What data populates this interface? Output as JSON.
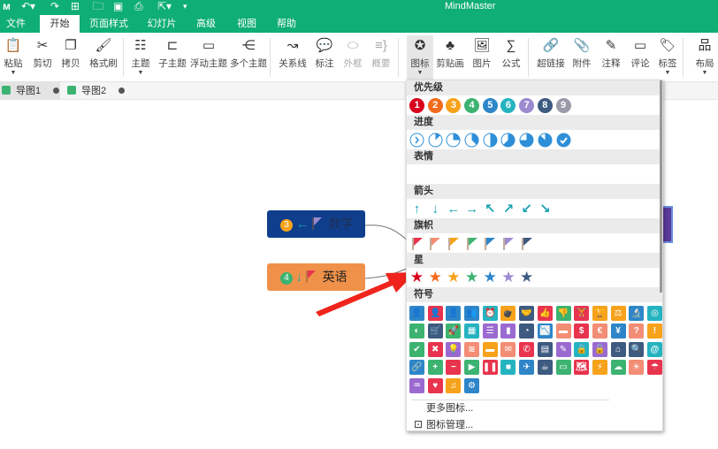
{
  "titlebar": {
    "title": "MindMaster",
    "quick_access": [
      "logo",
      "undo",
      "redo",
      "new",
      "open",
      "save",
      "print",
      "export",
      "more"
    ]
  },
  "menu_tabs": [
    "文件",
    "开始",
    "页面样式",
    "幻灯片",
    "高级",
    "视图",
    "帮助"
  ],
  "active_tab": "开始",
  "ribbon": [
    {
      "label": "粘贴",
      "icon": "paste-icon",
      "dropdown": true
    },
    {
      "label": "剪切",
      "icon": "scissors-icon"
    },
    {
      "label": "拷贝",
      "icon": "copy-icon"
    },
    {
      "label": "格式刷",
      "icon": "format-brush-icon"
    },
    {
      "label": "主题",
      "icon": "topic-icon",
      "dropdown": true
    },
    {
      "label": "子主题",
      "icon": "subtopic-icon"
    },
    {
      "label": "浮动主题",
      "icon": "floating-topic-icon"
    },
    {
      "label": "多个主题",
      "icon": "multiple-topics-icon"
    },
    {
      "label": "关系线",
      "icon": "relationship-icon"
    },
    {
      "label": "标注",
      "icon": "callout-icon"
    },
    {
      "label": "外框",
      "icon": "boundary-icon",
      "disabled": true
    },
    {
      "label": "概要",
      "icon": "summary-icon",
      "disabled": true
    },
    {
      "label": "图标",
      "icon": "icon-icon",
      "dropdown": true,
      "selected": true
    },
    {
      "label": "剪贴画",
      "icon": "clipart-icon"
    },
    {
      "label": "图片",
      "icon": "image-icon"
    },
    {
      "label": "公式",
      "icon": "formula-icon"
    },
    {
      "label": "超链接",
      "icon": "hyperlink-icon"
    },
    {
      "label": "附件",
      "icon": "attachment-icon"
    },
    {
      "label": "注释",
      "icon": "note-icon"
    },
    {
      "label": "评论",
      "icon": "comment-icon"
    },
    {
      "label": "标签",
      "icon": "tag-icon",
      "dropdown": true
    },
    {
      "label": "布局",
      "icon": "layout-icon",
      "dropdown": true
    }
  ],
  "doc_tabs": [
    "导图1",
    "导图2"
  ],
  "nodes": [
    {
      "label": "数学",
      "number": "3",
      "number_color": "#f7a21b",
      "arrow": "←",
      "flag_color": "#9b8ad0",
      "bg": "#0f3f8c",
      "text_color": "#1f2f55"
    },
    {
      "label": "英语",
      "number": "4",
      "number_color": "#3cb371",
      "arrow": "↓",
      "flag_color": "#e8344e",
      "bg": "#f0914a",
      "text_color": "#222"
    }
  ],
  "icon_panel": {
    "sections": {
      "priority": {
        "title": "优先级",
        "items": [
          {
            "n": "1",
            "c": "#d9001b"
          },
          {
            "n": "2",
            "c": "#f26b1d"
          },
          {
            "n": "3",
            "c": "#f7a21b"
          },
          {
            "n": "4",
            "c": "#3cb371"
          },
          {
            "n": "5",
            "c": "#2e86c9"
          },
          {
            "n": "6",
            "c": "#26b3c0"
          },
          {
            "n": "7",
            "c": "#9b8ad0"
          },
          {
            "n": "8",
            "c": "#3d5a80"
          },
          {
            "n": "9",
            "c": "#9a9aa8"
          }
        ]
      },
      "progress": {
        "title": "进度",
        "items": [
          0,
          12.5,
          25,
          37.5,
          50,
          62.5,
          75,
          87.5,
          100
        ]
      },
      "emoji": {
        "title": "表情",
        "items": [
          "😁",
          "😊",
          "😐",
          "😒",
          "😡",
          "😭",
          "😠",
          "😲",
          "😏",
          "😑",
          "😵",
          "😆",
          "😶",
          "😍"
        ]
      },
      "arrows": {
        "title": "箭头",
        "items": [
          "↑",
          "↓",
          "←",
          "→",
          "↖",
          "↗",
          "↙",
          "↘"
        ],
        "color": "#1aa3b0"
      },
      "flags": {
        "title": "旗帜",
        "items": [
          "#e8344e",
          "#f38d75",
          "#f7a21b",
          "#3cb371",
          "#2e86c9",
          "#9b8ad0",
          "#3d5a80"
        ]
      },
      "stars": {
        "title": "星",
        "items": [
          "#d9001b",
          "#f26b1d",
          "#f7a21b",
          "#3cb371",
          "#2e86c9",
          "#9b8ad0",
          "#3d5a80"
        ]
      },
      "symbols": {
        "title": "符号",
        "rows": [
          [
            [
              "👤",
              "#2e86c9"
            ],
            [
              "👤",
              "#e8344e"
            ],
            [
              "👤",
              "#2e86c9"
            ],
            [
              "👥",
              "#2e86c9"
            ],
            [
              "⏰",
              "#26b3c0"
            ],
            [
              "💣",
              "#f7a21b"
            ],
            [
              "🤝",
              "#3d5a80"
            ],
            [
              "👍",
              "#e8344e"
            ],
            [
              "👎",
              "#3cb371"
            ],
            [
              "🏋",
              "#e8344e"
            ],
            [
              "🏆",
              "#f7a21b"
            ],
            [
              "⚖",
              "#f7a21b"
            ],
            [
              "🔬",
              "#2e86c9"
            ],
            [
              "◎",
              "#26b3c0"
            ]
          ],
          [
            [
              "◐",
              "#3cb371"
            ],
            [
              "🛒",
              "#3d5a80"
            ],
            [
              "🚀",
              "#3cb371"
            ],
            [
              "▦",
              "#26b3c0"
            ],
            [
              "☰",
              "#9b6ad0"
            ],
            [
              "▮",
              "#9b6ad0"
            ],
            [
              "◔",
              "#3d5a80"
            ],
            [
              "📉",
              "#2e86c9"
            ],
            [
              "▬",
              "#f38d75"
            ],
            [
              "$",
              "#e8344e"
            ],
            [
              "€",
              "#f38d75"
            ],
            [
              "¥",
              "#2e86c9"
            ],
            [
              "?",
              "#f38d75"
            ],
            [
              "!",
              "#f7a21b"
            ]
          ],
          [
            [
              "✔",
              "#3cb371"
            ],
            [
              "✖",
              "#e8344e"
            ],
            [
              "💡",
              "#9b6ad0"
            ],
            [
              "≋",
              "#f38d75"
            ],
            [
              "▬",
              "#f7a21b"
            ],
            [
              "✉",
              "#f38d75"
            ],
            [
              "✆",
              "#e8344e"
            ],
            [
              "▤",
              "#3d5a80"
            ],
            [
              "✎",
              "#9b6ad0"
            ],
            [
              "🔒",
              "#26b3c0"
            ],
            [
              "🔓",
              "#9b6ad0"
            ],
            [
              "⌂",
              "#3d5a80"
            ],
            [
              "🔍",
              "#3d5a80"
            ],
            [
              "@",
              "#26b3c0"
            ]
          ],
          [
            [
              "🔗",
              "#2e86c9"
            ],
            [
              "+",
              "#3cb371"
            ],
            [
              "−",
              "#e8344e"
            ],
            [
              "▶",
              "#3cb371"
            ],
            [
              "❚❚",
              "#e8344e"
            ],
            [
              "■",
              "#26b3c0"
            ],
            [
              "✈",
              "#2e86c9"
            ],
            [
              "☕",
              "#3d5a80"
            ],
            [
              "▭",
              "#3cb371"
            ],
            [
              "🗺",
              "#e8344e"
            ],
            [
              "⚡",
              "#f7a21b"
            ],
            [
              "☁",
              "#3cb371"
            ],
            [
              "☀",
              "#f38d75"
            ],
            [
              "☂",
              "#e8344e"
            ]
          ],
          [
            [
              "♒",
              "#9b6ad0"
            ],
            [
              "♥",
              "#e8344e"
            ],
            [
              "♫",
              "#f7a21b"
            ],
            [
              "⚙",
              "#2e86c9"
            ]
          ]
        ]
      }
    },
    "more_icons": "更多图标...",
    "manage_icons": "图标管理..."
  }
}
